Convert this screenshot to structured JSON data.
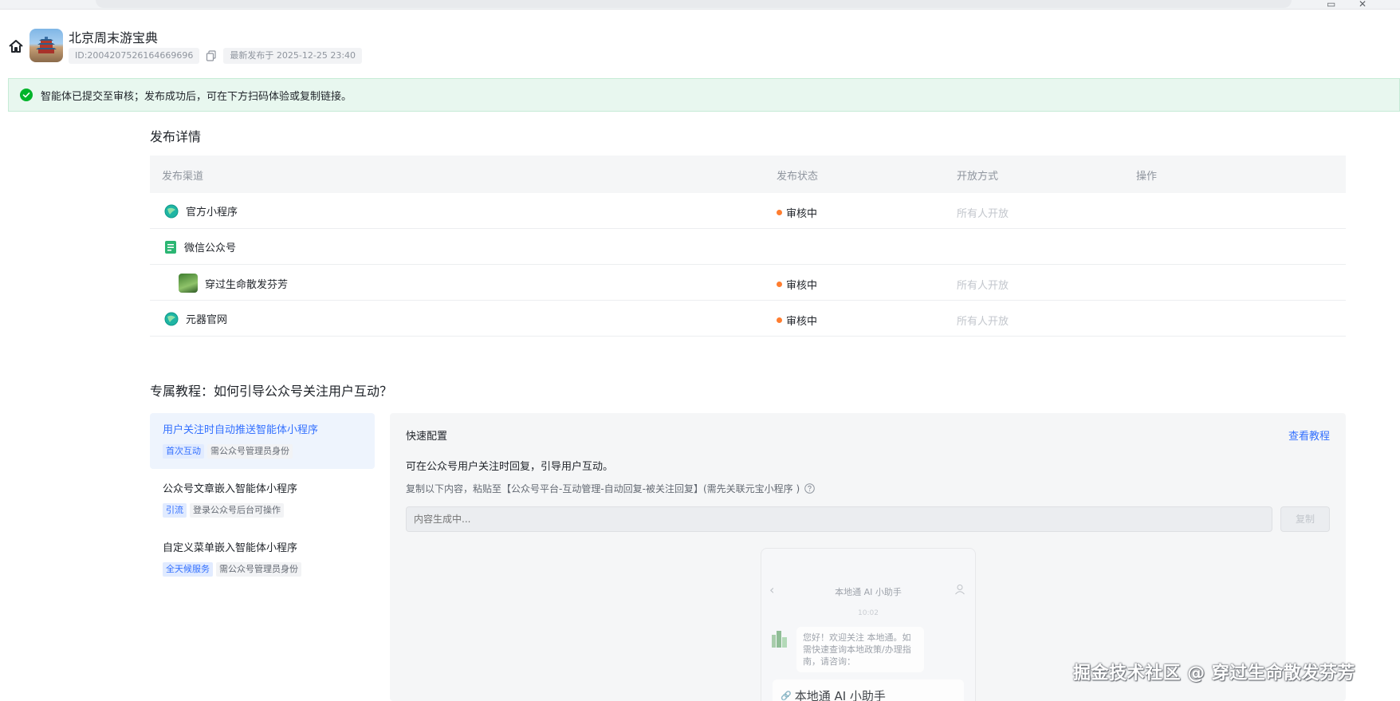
{
  "header": {
    "title": "北京周末游宝典",
    "id_label": "ID:2004207526164669696",
    "publish_time": "最新发布于 2025-12-25 23:40"
  },
  "banner": {
    "text": "智能体已提交至审核；发布成功后，可在下方扫码体验或复制链接。"
  },
  "publish": {
    "section_title": "发布详情",
    "columns": [
      "发布渠道",
      "发布状态",
      "开放方式",
      "操作"
    ],
    "rows": [
      {
        "channel": "官方小程序",
        "icon": "globe-icon",
        "status": "审核中",
        "access": "所有人开放"
      },
      {
        "channel": "微信公众号",
        "icon": "document-icon",
        "status": "",
        "access": ""
      },
      {
        "channel": "穿过生命散发芬芳",
        "icon": "account-photo-icon",
        "status": "审核中",
        "access": "所有人开放"
      },
      {
        "channel": "元器官网",
        "icon": "globe-icon",
        "status": "审核中",
        "access": "所有人开放"
      }
    ]
  },
  "tutorial": {
    "section_title": "专属教程：如何引导公众号关注用户互动？",
    "items": [
      {
        "title": "用户关注时自动推送智能体小程序",
        "tag": "首次互动",
        "note": "需公众号管理员身份"
      },
      {
        "title": "公众号文章嵌入智能体小程序",
        "tag": "引流",
        "note": "登录公众号后台可操作"
      },
      {
        "title": "自定义菜单嵌入智能体小程序",
        "tag": "全天候服务",
        "note": "需公众号管理员身份"
      }
    ],
    "panel": {
      "title": "快速配置",
      "view_link": "查看教程",
      "desc1": "可在公众号用户关注时回复，引导用户互动。",
      "desc2": "复制以下内容，粘贴至【公众号平台-互动管理-自动回复-被关注回复】(需先关联元宝小程序 )",
      "input_placeholder": "内容生成中...",
      "copy_label": "复制",
      "phone": {
        "title": "本地通 AI 小助手",
        "time": "10:02",
        "bubble": "您好！欢迎关注 本地通。如需快速查询本地政策/办理指南，请咨询：",
        "card": "本地通 AI 小助手"
      }
    }
  },
  "watermark": "掘金技术社区 @ 穿过生命散发芬芳",
  "colors": {
    "accent": "#3370ff",
    "success_bg": "#e8f7ef",
    "success": "#00b42a",
    "status_dot": "#ff7d2f"
  }
}
